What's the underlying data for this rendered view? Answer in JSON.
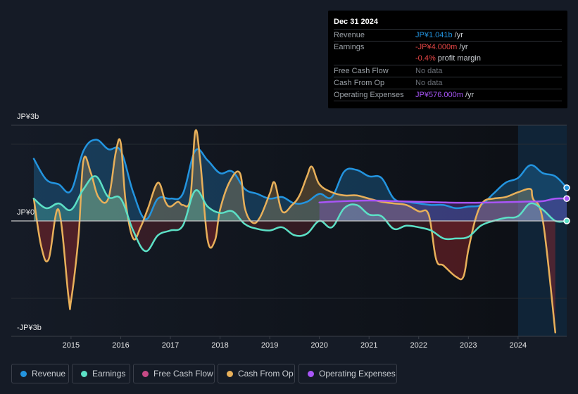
{
  "tooltip": {
    "date": "Dec 31 2024",
    "rows": [
      {
        "label": "Revenue",
        "value": "JP¥1.041b",
        "unit": " /yr",
        "color": "#2394df"
      },
      {
        "label": "Earnings",
        "value": "-JP¥4.000m",
        "unit": " /yr",
        "color": "#e64646"
      },
      {
        "label": "",
        "value": "-0.4%",
        "unit": " profit margin",
        "color": "#e64646"
      },
      {
        "label": "Free Cash Flow",
        "value": "No data",
        "unit": "",
        "color": "#6b7078"
      },
      {
        "label": "Cash From Op",
        "value": "No data",
        "unit": "",
        "color": "#6b7078"
      },
      {
        "label": "Operating Expenses",
        "value": "JP¥576.000m",
        "unit": " /yr",
        "color": "#a855f7"
      }
    ]
  },
  "chart_data": {
    "type": "area",
    "title": "",
    "xlabel": "",
    "ylabel": "",
    "y_tick_labels": [
      "JP¥3b",
      "JP¥0",
      "-JP¥3b"
    ],
    "x_tick_labels": [
      "2015",
      "2016",
      "2017",
      "2018",
      "2019",
      "2020",
      "2021",
      "2022",
      "2023",
      "2024"
    ],
    "xlim": [
      2014.25,
      2024.98
    ],
    "ylim": [
      -3.6,
      3.0
    ],
    "unit": "JP¥ billions",
    "grid": true,
    "legend_position": "bottom",
    "highlight_region": [
      2024.0,
      2024.98
    ],
    "series": [
      {
        "name": "Revenue",
        "color": "#2394df",
        "x": [
          2014.25,
          2014.5,
          2014.75,
          2015.0,
          2015.25,
          2015.5,
          2015.75,
          2016.0,
          2016.25,
          2016.5,
          2016.75,
          2017.0,
          2017.25,
          2017.5,
          2017.75,
          2018.0,
          2018.25,
          2018.5,
          2018.75,
          2019.0,
          2019.25,
          2019.5,
          2019.75,
          2020.0,
          2020.25,
          2020.5,
          2020.75,
          2021.0,
          2021.25,
          2021.5,
          2021.75,
          2022.0,
          2022.25,
          2022.5,
          2022.75,
          2023.0,
          2023.25,
          2023.5,
          2023.75,
          2024.0,
          2024.25,
          2024.5,
          2024.75,
          2024.98
        ],
        "values": [
          1.95,
          1.3,
          1.15,
          0.95,
          2.2,
          2.55,
          2.25,
          2.2,
          0.9,
          0.05,
          0.7,
          0.7,
          0.85,
          2.2,
          1.9,
          1.5,
          1.55,
          1.0,
          0.85,
          0.7,
          0.75,
          0.55,
          0.6,
          0.85,
          0.75,
          1.55,
          1.6,
          1.4,
          1.35,
          0.7,
          0.6,
          0.55,
          0.5,
          0.5,
          0.4,
          0.45,
          0.5,
          0.85,
          1.2,
          1.35,
          1.75,
          1.5,
          1.4,
          1.04
        ]
      },
      {
        "name": "Earnings",
        "color": "#5ce0c6",
        "x": [
          2014.25,
          2014.5,
          2014.75,
          2015.0,
          2015.25,
          2015.5,
          2015.75,
          2016.0,
          2016.25,
          2016.5,
          2016.75,
          2017.0,
          2017.25,
          2017.5,
          2017.75,
          2018.0,
          2018.25,
          2018.5,
          2018.75,
          2019.0,
          2019.25,
          2019.5,
          2019.75,
          2020.0,
          2020.25,
          2020.5,
          2020.75,
          2021.0,
          2021.25,
          2021.5,
          2021.75,
          2022.0,
          2022.25,
          2022.5,
          2022.75,
          2023.0,
          2023.25,
          2023.5,
          2023.75,
          2024.0,
          2024.25,
          2024.5,
          2024.75,
          2024.98
        ],
        "values": [
          0.7,
          0.4,
          0.55,
          0.35,
          1.0,
          1.4,
          0.75,
          0.7,
          -0.3,
          -0.95,
          -0.45,
          -0.3,
          -0.15,
          0.95,
          0.45,
          0.25,
          0.3,
          -0.1,
          -0.25,
          -0.3,
          -0.2,
          -0.45,
          -0.4,
          0.0,
          -0.2,
          0.4,
          0.5,
          0.2,
          0.15,
          -0.25,
          -0.15,
          -0.2,
          -0.3,
          -0.55,
          -0.55,
          -0.5,
          -0.15,
          0.0,
          0.1,
          0.15,
          0.55,
          0.35,
          0.0,
          0.0
        ]
      },
      {
        "name": "Free Cash Flow",
        "color": "#c74a86",
        "x": [],
        "values": []
      },
      {
        "name": "Cash From Op",
        "color": "#e8b05a",
        "x": [
          2014.25,
          2014.4,
          2014.55,
          2014.75,
          2014.95,
          2015.0,
          2015.15,
          2015.25,
          2015.4,
          2015.55,
          2015.75,
          2015.9,
          2016.0,
          2016.1,
          2016.25,
          2016.4,
          2016.55,
          2016.75,
          2016.9,
          2017.0,
          2017.15,
          2017.25,
          2017.4,
          2017.5,
          2017.6,
          2017.75,
          2017.9,
          2018.0,
          2018.2,
          2018.4,
          2018.5,
          2018.65,
          2018.8,
          2019.0,
          2019.1,
          2019.25,
          2019.45,
          2019.6,
          2019.75,
          2019.85,
          2020.0,
          2020.25,
          2020.5,
          2020.75,
          2021.0,
          2021.25,
          2021.5,
          2021.75,
          2022.0,
          2022.2,
          2022.35,
          2022.5,
          2022.75,
          2022.9,
          2023.0,
          2023.15,
          2023.3,
          2023.5,
          2023.75,
          2024.0,
          2024.25,
          2024.3,
          2024.5,
          2024.75
        ],
        "values": [
          0.7,
          -0.8,
          -1.2,
          0.35,
          -2.4,
          -2.5,
          -0.5,
          1.9,
          1.5,
          0.75,
          0.7,
          2.15,
          2.45,
          0.6,
          -0.55,
          -0.2,
          0.4,
          1.2,
          0.6,
          0.45,
          0.6,
          0.5,
          0.7,
          2.8,
          1.9,
          -0.6,
          -0.6,
          0.35,
          1.25,
          1.5,
          0.4,
          -0.05,
          0.1,
          0.85,
          1.2,
          0.3,
          0.5,
          0.8,
          1.4,
          1.7,
          1.15,
          0.9,
          0.8,
          0.8,
          0.7,
          0.6,
          0.55,
          0.5,
          0.3,
          0.2,
          -1.2,
          -1.4,
          -1.75,
          -1.75,
          -0.9,
          0.1,
          0.6,
          0.7,
          0.75,
          0.9,
          1.0,
          0.7,
          0.0,
          -3.5
        ]
      },
      {
        "name": "Operating Expenses",
        "color": "#a855f7",
        "x": [
          2020.0,
          2020.5,
          2021.0,
          2021.5,
          2022.0,
          2022.5,
          2023.0,
          2023.5,
          2024.0,
          2024.25,
          2024.5,
          2024.75,
          2024.98
        ],
        "values": [
          0.58,
          0.62,
          0.64,
          0.62,
          0.6,
          0.58,
          0.57,
          0.58,
          0.6,
          0.61,
          0.62,
          0.7,
          0.7
        ]
      }
    ]
  },
  "legend": [
    {
      "label": "Revenue",
      "color": "#2394df"
    },
    {
      "label": "Earnings",
      "color": "#5ce0c6"
    },
    {
      "label": "Free Cash Flow",
      "color": "#c74a86"
    },
    {
      "label": "Cash From Op",
      "color": "#e8b05a"
    },
    {
      "label": "Operating Expenses",
      "color": "#a855f7"
    }
  ]
}
